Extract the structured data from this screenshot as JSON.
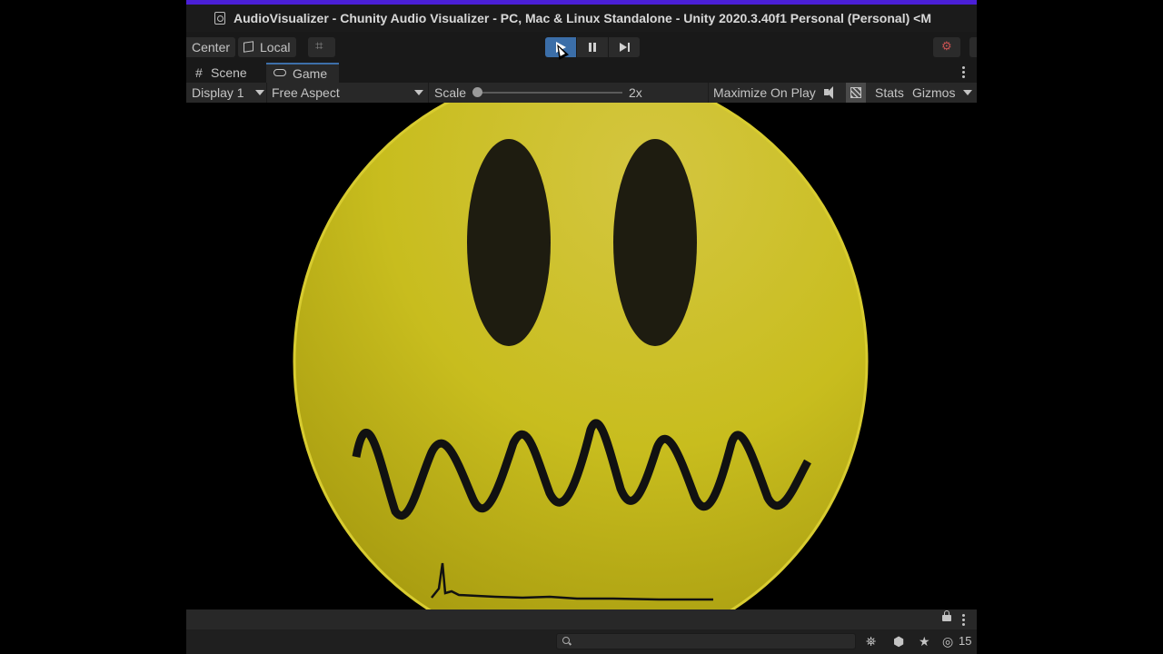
{
  "window": {
    "title": "AudioVisualizer - Chunity Audio Visualizer - PC, Mac & Linux Standalone - Unity 2020.3.40f1 Personal (Personal) <M"
  },
  "toolbar": {
    "pivot_label": "Center",
    "space_label": "Local"
  },
  "tabs": [
    {
      "label": "Scene",
      "icon": "hash-icon"
    },
    {
      "label": "Game",
      "icon": "gamepad-icon",
      "active": true
    }
  ],
  "game_toolbar": {
    "display": "Display 1",
    "aspect": "Free Aspect",
    "scale_label": "Scale",
    "scale_value": "2x",
    "maximize_label": "Maximize On Play",
    "stats_label": "Stats",
    "gizmos_label": "Gizmos"
  },
  "colors": {
    "accent": "#4a1fd6",
    "play_active": "#3b6ea8",
    "face_yellow": "#c8c020"
  },
  "status": {
    "hidden_count": "15"
  },
  "search": {
    "placeholder": ""
  }
}
